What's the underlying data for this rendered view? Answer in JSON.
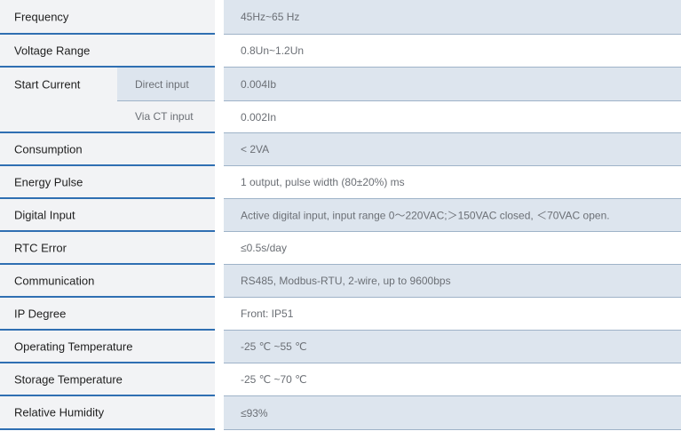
{
  "specs": {
    "frequency": {
      "label": "Frequency",
      "value": "45Hz~65 Hz"
    },
    "voltage_range": {
      "label": "Voltage Range",
      "value": "0.8Un~1.2Un"
    },
    "start_current": {
      "label": "Start Current",
      "direct_label": "Direct input",
      "direct_value": "0.004Ib",
      "ct_label": "Via CT input",
      "ct_value": "0.002In"
    },
    "consumption": {
      "label": "Consumption",
      "value": "< 2VA"
    },
    "energy_pulse": {
      "label": "Energy Pulse",
      "value": "1 output, pulse width (80±20%) ms"
    },
    "digital_input": {
      "label": "Digital Input",
      "value": "Active digital input, input range 0～220VAC;＞150VAC closed, ＜70VAC open."
    },
    "rtc_error": {
      "label": "RTC Error",
      "value": "≤0.5s/day"
    },
    "communication": {
      "label": "Communication",
      "value": "RS485, Modbus-RTU, 2-wire, up to 9600bps"
    },
    "ip_degree": {
      "label": "IP Degree",
      "value": "Front: IP51"
    },
    "operating_temperature": {
      "label": "Operating Temperature",
      "value": "-25 ℃ ~55 ℃"
    },
    "storage_temperature": {
      "label": "Storage Temperature",
      "value": "-25 ℃ ~70 ℃"
    },
    "relative_humidity": {
      "label": "Relative Humidity",
      "value": "≤93%"
    }
  }
}
